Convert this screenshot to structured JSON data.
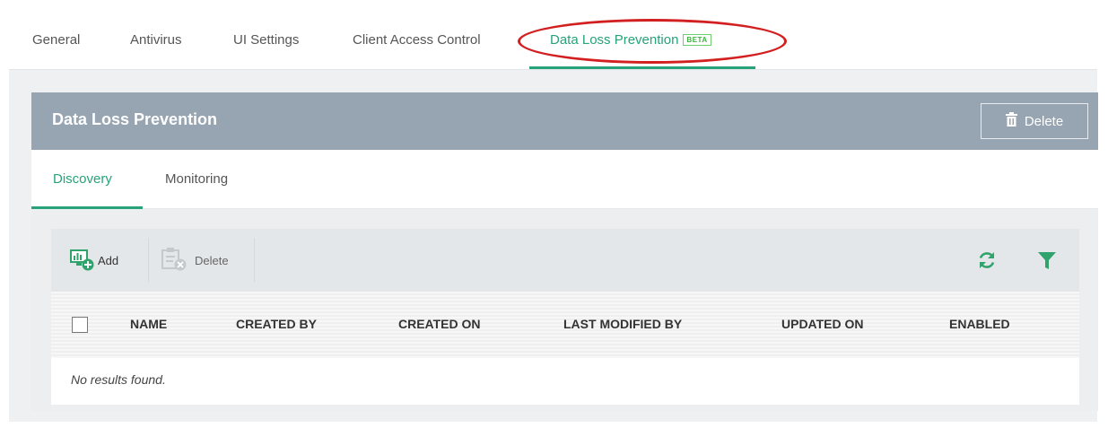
{
  "tabs": [
    {
      "label": "General",
      "active": false
    },
    {
      "label": "Antivirus",
      "active": false
    },
    {
      "label": "UI Settings",
      "active": false
    },
    {
      "label": "Client Access Control",
      "active": false
    },
    {
      "label": "Data Loss Prevention",
      "active": true,
      "badge": "BETA"
    }
  ],
  "panel": {
    "title": "Data Loss Prevention",
    "delete_label": "Delete"
  },
  "subtabs": [
    {
      "label": "Discovery",
      "active": true
    },
    {
      "label": "Monitoring",
      "active": false
    }
  ],
  "toolbar": {
    "add_label": "Add",
    "delete_label": "Delete"
  },
  "table": {
    "columns": [
      "NAME",
      "CREATED BY",
      "CREATED ON",
      "LAST MODIFIED BY",
      "UPDATED ON",
      "ENABLED"
    ],
    "empty_message": "No results found."
  },
  "colors": {
    "accent": "#27a27a",
    "header": "#97a4b1",
    "highlight": "#d21f1f"
  },
  "icons": {
    "header_delete": "trash-icon",
    "add": "add-monitor-icon",
    "delete": "delete-clipboard-icon",
    "refresh": "refresh-icon",
    "filter": "filter-icon"
  }
}
